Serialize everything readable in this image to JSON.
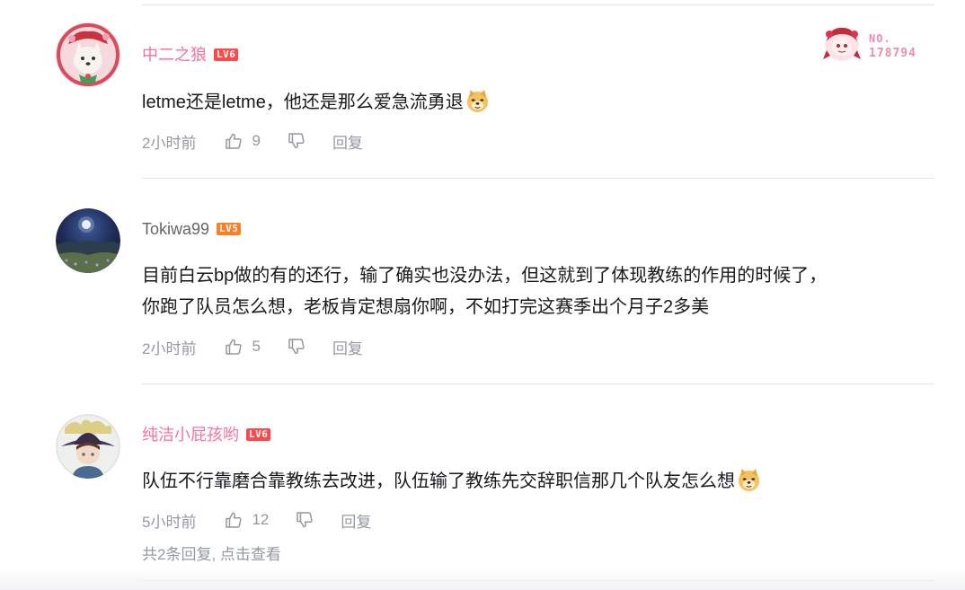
{
  "comments": [
    {
      "username": "中二之狼",
      "level": "LV6",
      "text": "letme还是letme，他还是那么爱急流勇退",
      "time": "2小时前",
      "likes": "9",
      "reply": "回复",
      "fan_badge": {
        "no_label": "NO.",
        "number": "178794"
      }
    },
    {
      "username": "Tokiwa99",
      "level": "LV5",
      "text_line1": "目前白云bp做的有的还行，输了确实也没办法，但这就到了体现教练的作用的时候了，",
      "text_line2": "你跑了队员怎么想，老板肯定想扇你啊，不如打完这赛季出个月子2多美",
      "time": "2小时前",
      "likes": "5",
      "reply": "回复"
    },
    {
      "username": "纯洁小屁孩哟",
      "level": "LV6",
      "text": "队伍不行靠磨合靠教练去改进，队伍输了教练先交辞职信那几个队友怎么想",
      "time": "5小时前",
      "likes": "12",
      "reply": "回复",
      "replies_summary": "共2条回复, ",
      "replies_link": "点击查看"
    }
  ],
  "colors": {
    "vip_name": "#fb7299",
    "normal_name": "#61666d",
    "meta": "#9499a0",
    "lv6": "#ff4949",
    "lv5": "#ff7f24"
  },
  "icons": [
    "thumbs-up-icon",
    "thumbs-down-icon",
    "doge-emoji-icon"
  ]
}
